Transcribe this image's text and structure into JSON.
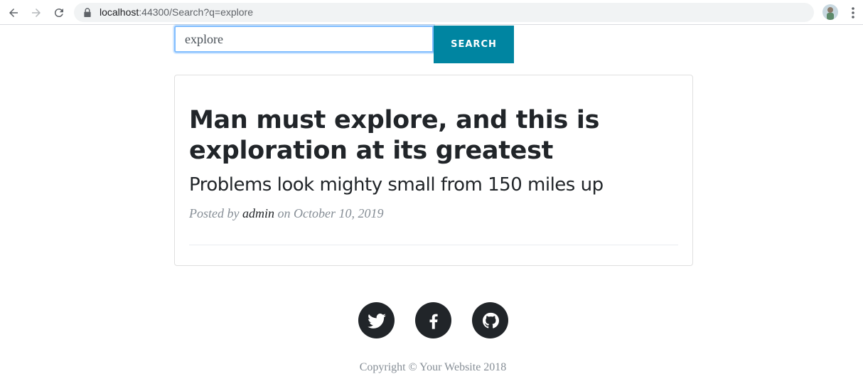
{
  "browser": {
    "url_host": "localhost",
    "url_path": ":44300/Search?q=explore"
  },
  "search": {
    "value": "explore",
    "button_label": "SEARCH"
  },
  "post": {
    "title": "Man must explore, and this is exploration at its greatest",
    "subtitle": "Problems look mighty small from 150 miles up",
    "meta_prefix": "Posted by ",
    "author": "admin",
    "meta_suffix": " on October 10, 2019"
  },
  "social": [
    "twitter-icon",
    "facebook-icon",
    "github-icon"
  ],
  "footer": {
    "copyright": "Copyright © Your Website 2018"
  },
  "colors": {
    "accent": "#0085a1",
    "dark": "#212529",
    "muted": "#868e96"
  }
}
